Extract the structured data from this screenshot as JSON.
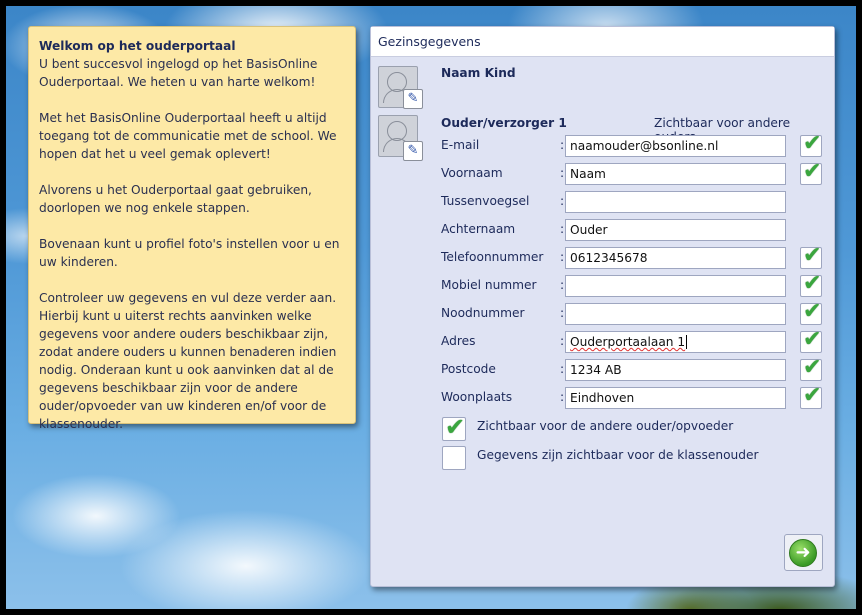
{
  "welcome": {
    "title": "Welkom op het ouderportaal",
    "paragraphs": [
      "U bent succesvol ingelogd op het BasisOnline Ouderportaal. We heten u van harte welkom!",
      "Met het BasisOnline Ouderportaal heeft u altijd toegang tot de communicatie met de school. We hopen dat het u veel gemak oplevert!",
      "Alvorens u het Ouderportaal gaat gebruiken, doorlopen we nog enkele stappen.",
      "Bovenaan kunt u profiel foto's instellen voor u en uw kinderen.",
      "Controleer uw gegevens en vul deze verder aan. Hierbij kunt u uiterst rechts aanvinken welke gegevens voor andere ouders beschikbaar zijn, zodat andere ouders u kunnen benaderen indien nodig. Onderaan kunt u ook aanvinken dat al de gegevens beschikbaar zijn voor de andere ouder/opvoeder van uw kinderen en/of voor de klassenouder."
    ]
  },
  "panel": {
    "title": "Gezinsgegevens",
    "child_name": "Naam Kind",
    "parent_heading": "Ouder/verzorger 1",
    "visibility_heading": "Zichtbaar voor andere ouders",
    "fields": [
      {
        "label": "E-mail",
        "value": "naamouder@bsonline.nl",
        "visible": true
      },
      {
        "label": "Voornaam",
        "value": "Naam",
        "visible": true
      },
      {
        "label": "Tussenvoegsel",
        "value": "",
        "visible": null
      },
      {
        "label": "Achternaam",
        "value": "Ouder",
        "visible": null
      },
      {
        "label": "Telefoonnummer",
        "value": "0612345678",
        "visible": true
      },
      {
        "label": "Mobiel nummer",
        "value": "",
        "visible": true
      },
      {
        "label": "Noodnummer",
        "value": "",
        "visible": true
      },
      {
        "label": "Adres",
        "value": "Ouderportaalaan 1",
        "visible": true
      },
      {
        "label": "Postcode",
        "value": "1234 AB",
        "visible": true
      },
      {
        "label": "Woonplaats",
        "value": "Eindhoven",
        "visible": true
      }
    ],
    "colon": ":",
    "option_other_parent": {
      "label": "Zichtbaar voor de andere ouder/opvoeder",
      "checked": true
    },
    "option_class_parent": {
      "label": "Gegevens zijn zichtbaar voor de klassenouder",
      "checked": false
    }
  },
  "icons": {
    "edit": "pencil-icon",
    "check": "check-icon",
    "next": "arrow-right-icon"
  },
  "glyphs": {
    "pencil": "✎",
    "tick": "✔",
    "arrow": "➜"
  },
  "colors": {
    "welcome_bg": "#fde9a6",
    "panel_bg": "#dfe3f3",
    "check_green": "#3aa63e",
    "heading_text": "#1d2a5a"
  }
}
